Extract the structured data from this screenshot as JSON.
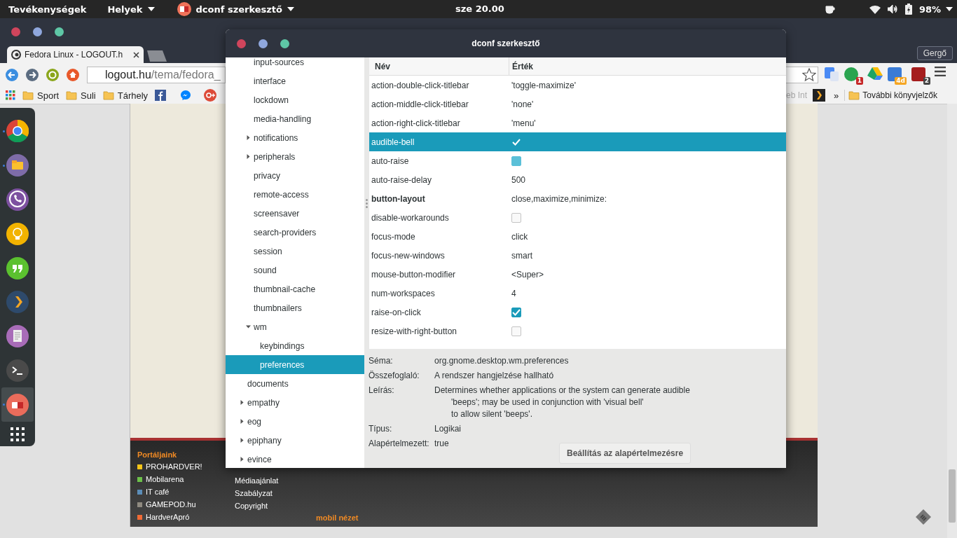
{
  "topbar": {
    "activities": "Tevékenységek",
    "places": "Helyek",
    "app": "dconf szerkesztő",
    "clock": "sze 20.00",
    "battery": "98%"
  },
  "browser": {
    "tab_title": "Fedora Linux - LOGOUT.h",
    "user": "Gergő",
    "url": {
      "host": "logout.hu",
      "path": "/tema/fedora_"
    },
    "extensions": [
      {
        "badge": "1"
      },
      {
        "badge": "4d"
      },
      {
        "badge": "2"
      }
    ],
    "bookmarks": [
      "Sport",
      "Suli",
      "Tárhely"
    ],
    "bookmark_partial": "eb Int",
    "bookmarks_overflow": "»",
    "other_bookmarks": "További könyvjelzők"
  },
  "dock": [
    {
      "running": true,
      "active": false
    },
    {
      "running": true,
      "active": false
    },
    {
      "running": false,
      "active": false
    },
    {
      "running": false,
      "active": false
    },
    {
      "running": false,
      "active": false
    },
    {
      "running": false,
      "active": false
    },
    {
      "running": false,
      "active": false
    },
    {
      "running": false,
      "active": false
    },
    {
      "running": true,
      "active": true
    }
  ],
  "page_footer": {
    "heading": "Portáljaink",
    "portals": [
      {
        "label": "PROHARDVER!",
        "color": "#f5c518"
      },
      {
        "label": "Mobilarena",
        "color": "#6cc04a"
      },
      {
        "label": "IT café",
        "color": "#5b8db8"
      },
      {
        "label": "GAMEPOD.hu",
        "color": "#8f8a80"
      },
      {
        "label": "HardverApró",
        "color": "#f06a35"
      }
    ],
    "links": [
      "Médiaajánlat",
      "Szabályzat",
      "Copyright"
    ],
    "mobile_view": "mobil nézet"
  },
  "dconf": {
    "title": "dconf szerkesztő",
    "tree": [
      {
        "children": [
          {
            "label": "input-sources",
            "selected": false
          },
          {
            "label": "interface",
            "selected": false
          },
          {
            "label": "lockdown",
            "selected": false
          },
          {
            "label": "media-handling",
            "selected": false
          },
          {
            "label": "notifications",
            "selected": false,
            "expanded": false
          },
          {
            "label": "peripherals",
            "selected": false,
            "expanded": false
          },
          {
            "label": "privacy",
            "selected": false
          },
          {
            "label": "remote-access",
            "selected": false
          },
          {
            "label": "screensaver",
            "selected": false
          },
          {
            "label": "search-providers",
            "selected": false
          },
          {
            "label": "session",
            "selected": false
          },
          {
            "label": "sound",
            "selected": false
          },
          {
            "label": "thumbnail-cache",
            "selected": false
          },
          {
            "label": "thumbnailers",
            "selected": false
          },
          {
            "label": "wm",
            "selected": false,
            "expanded": true,
            "children": [
              {
                "label": "keybindings",
                "selected": false
              },
              {
                "label": "preferences",
                "selected": true
              }
            ]
          }
        ]
      },
      {
        "label": "documents",
        "selected": false
      },
      {
        "label": "empathy",
        "selected": false,
        "expanded": false
      },
      {
        "label": "eog",
        "selected": false,
        "expanded": false
      },
      {
        "label": "epiphany",
        "selected": false,
        "expanded": false
      },
      {
        "label": "evince",
        "selected": false,
        "expanded": false
      }
    ],
    "columns": [
      "Név",
      "Érték"
    ],
    "rows": [
      {
        "name": "action-double-click-titlebar",
        "kind": "text",
        "value": "'toggle-maximize'",
        "selected": false,
        "modified": false
      },
      {
        "name": "action-middle-click-titlebar",
        "kind": "text",
        "value": "'none'",
        "selected": false,
        "modified": false
      },
      {
        "name": "action-right-click-titlebar",
        "kind": "text",
        "value": "'menu'",
        "selected": false,
        "modified": false
      },
      {
        "name": "audible-bell",
        "kind": "check",
        "checked": true,
        "selected": true,
        "modified": false
      },
      {
        "name": "auto-raise",
        "kind": "check",
        "checked": false,
        "hovered": true,
        "selected": false,
        "modified": false
      },
      {
        "name": "auto-raise-delay",
        "kind": "text",
        "value": "500",
        "selected": false,
        "modified": false
      },
      {
        "name": "button-layout",
        "kind": "text",
        "value": "close,maximize,minimize:",
        "selected": false,
        "modified": true
      },
      {
        "name": "disable-workarounds",
        "kind": "check",
        "checked": false,
        "hovered": false,
        "selected": false,
        "modified": false
      },
      {
        "name": "focus-mode",
        "kind": "text",
        "value": "click",
        "selected": false,
        "modified": false
      },
      {
        "name": "focus-new-windows",
        "kind": "text",
        "value": "smart",
        "selected": false,
        "modified": false
      },
      {
        "name": "mouse-button-modifier",
        "kind": "text",
        "value": "<Super>",
        "selected": false,
        "modified": false
      },
      {
        "name": "num-workspaces",
        "kind": "text",
        "value": "4",
        "selected": false,
        "modified": false
      },
      {
        "name": "raise-on-click",
        "kind": "check",
        "checked": true,
        "selected": false,
        "modified": false
      },
      {
        "name": "resize-with-right-button",
        "kind": "check",
        "checked": false,
        "hovered": false,
        "selected": false,
        "modified": false
      }
    ],
    "details": [
      {
        "label": "Séma:",
        "lines": [
          "org.gnome.desktop.wm.preferences"
        ]
      },
      {
        "label": "Összefoglaló:",
        "lines": [
          "A rendszer hangjelzése hallható"
        ]
      },
      {
        "label": "Leírás:",
        "lines": [
          "Determines whether applications or the system can generate audible",
          "'beeps'; may be used in conjunction with 'visual bell'",
          "to allow silent 'beeps'."
        ]
      },
      {
        "label": "Típus:",
        "lines": [
          "Logikai"
        ]
      },
      {
        "label": "Alapértelmezett:",
        "lines": [
          "true"
        ]
      }
    ],
    "reset_button": "Beállítás az alapértelmezésre"
  }
}
